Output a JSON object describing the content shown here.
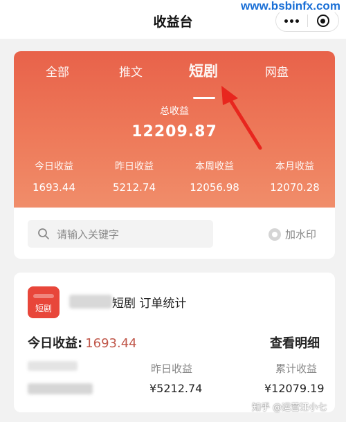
{
  "watermark_top": "www.bsbinfx.com",
  "header": {
    "title": "收益台"
  },
  "tabs": [
    {
      "label": "全部"
    },
    {
      "label": "推文"
    },
    {
      "label": "短剧",
      "active": true
    },
    {
      "label": "网盘"
    }
  ],
  "summary": {
    "total_label": "总收益",
    "total_value": "12209.87",
    "stats": [
      {
        "label": "今日收益",
        "value": "1693.44"
      },
      {
        "label": "昨日收益",
        "value": "5212.74"
      },
      {
        "label": "本周收益",
        "value": "12056.98"
      },
      {
        "label": "本月收益",
        "value": "12070.28"
      }
    ]
  },
  "search": {
    "placeholder": "请输入关键字"
  },
  "watermark_toggle": {
    "label": "加水印"
  },
  "order_card": {
    "icon_label": "短剧",
    "title": "短剧 订单统计",
    "today_label": "今日收益:",
    "today_value": "1693.44",
    "detail_label": "查看明细",
    "columns": [
      {
        "label": "昨日收益",
        "value": "¥5212.74"
      },
      {
        "label": "累计收益",
        "value": "¥12079.19"
      }
    ]
  },
  "watermark_bottom": "知乎 @运营汪小七",
  "colors": {
    "accent": "#e8624a",
    "amount": "#c0574a",
    "arrow": "#e8261e"
  }
}
